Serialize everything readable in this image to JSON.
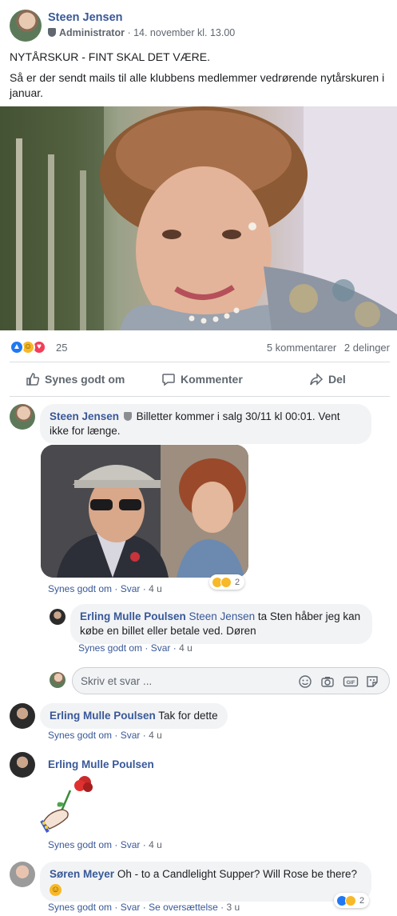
{
  "post": {
    "author": "Steen Jensen",
    "role": "Administrator",
    "timestamp": "· 14. november kl. 13.00",
    "title": "NYTÅRSKUR - FINT SKAL DET VÆRE.",
    "body": "Så er der sendt mails til alle klubbens medlemmer vedrørende nytårskuren i januar.",
    "reaction_count": "25",
    "comments_count": "5 kommentarer",
    "shares_count": "2 delinger"
  },
  "actions": {
    "like": "Synes godt om",
    "comment": "Kommenter",
    "share": "Del"
  },
  "comments": [
    {
      "author": "Steen Jensen",
      "text": "Billetter kommer i salg 30/11 kl 00:01. Vent ikke for længe.",
      "like": "Synes godt om",
      "reply": "Svar",
      "time": "4 u",
      "reaction_count": "2"
    },
    {
      "author": "Erling Mulle Poulsen",
      "mention": "Steen Jensen",
      "text": " ta Sten håber jeg kan købe en billet eller betale ved. Døren",
      "like": "Synes godt om",
      "reply": "Svar",
      "time": "4 u"
    },
    {
      "author": "Erling Mulle Poulsen",
      "text": "Tak for dette",
      "like": "Synes godt om",
      "reply": "Svar",
      "time": "4 u"
    },
    {
      "author": "Erling Mulle Poulsen",
      "text": "",
      "like": "Synes godt om",
      "reply": "Svar",
      "time": "4 u"
    },
    {
      "author": "Søren Meyer",
      "text": "Oh - to a Candlelight Supper? Will Rose be there?",
      "emoji": "☺",
      "like": "Synes godt om",
      "reply": "Svar",
      "translate": "Se oversættelse",
      "time": "3 u",
      "reaction_count": "2"
    }
  ],
  "reply_box": {
    "placeholder": "Skriv et svar ..."
  },
  "icons": [
    "shield-icon",
    "like-icon",
    "comment-icon",
    "share-icon",
    "emoji-icon",
    "camera-icon",
    "gif-icon",
    "sticker-icon"
  ],
  "colors": {
    "link": "#385898",
    "meta": "#606770",
    "bubble": "#f2f3f5",
    "like": "#2078f4",
    "love": "#f33e58",
    "haha": "#f7b928"
  }
}
